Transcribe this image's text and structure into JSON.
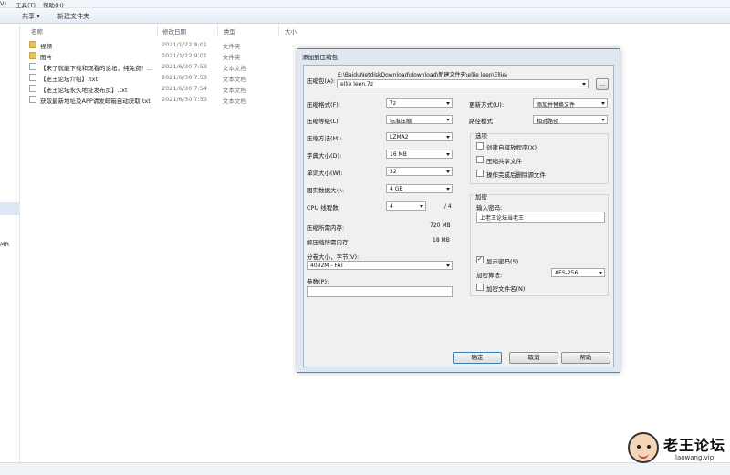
{
  "menu": [
    "V)",
    "工具(T)",
    "帮助(H)"
  ],
  "toolbar": {
    "share": "共享 ▾",
    "new_folder": "新建文件夹"
  },
  "columns": {
    "name": "名称",
    "date": "修改日期",
    "type": "类型",
    "size": "大小"
  },
  "files": [
    {
      "name": "视频",
      "date": "2021/1/22 9:01",
      "type": "文件夹",
      "kind": "folder"
    },
    {
      "name": "图片",
      "date": "2021/1/22 9:01",
      "type": "文件夹",
      "kind": "folder"
    },
    {
      "name": "【来了就能下载和观看的论坛，纯免费！...",
      "date": "2021/6/30 7:53",
      "type": "文本文档",
      "kind": "file"
    },
    {
      "name": "【老王论坛介绍】.txt",
      "date": "2021/6/30 7:53",
      "type": "文本文档",
      "kind": "file"
    },
    {
      "name": "【老王论坛永久地址发布页】.txt",
      "date": "2021/6/30 7:54",
      "type": "文本文档",
      "kind": "file"
    },
    {
      "name": "获取最新地址及APP请发邮箱自动获取.txt",
      "date": "2021/6/30 7:53",
      "type": "文本文档",
      "kind": "file"
    }
  ],
  "nav": {
    "partial_text": "MR"
  },
  "dialog": {
    "title": "添加到压缩包",
    "archive_label": "压缩包(A):",
    "archive_path": "E:\\BaiduNetdiskDownload\\download\\新建文件夹\\ellie leen\\Ellie\\",
    "archive_name": "ellie leen.7z",
    "browse_label": "...",
    "format_label": "压缩格式(F):",
    "format_value": "7z",
    "level_label": "压缩等级(L):",
    "level_value": "标准压缩",
    "method_label": "压缩方法(M):",
    "method_value": "LZMA2",
    "dict_label": "字典大小(D):",
    "dict_value": "16 MB",
    "word_label": "单词大小(W):",
    "word_value": "32",
    "solid_label": "固实数据大小:",
    "solid_value": "4 GB",
    "cpu_label": "CPU 线程数:",
    "cpu_value": "4",
    "cpu_total": "/ 4",
    "mem_comp_label": "压缩所需内存:",
    "mem_comp_value": "720 MB",
    "mem_decomp_label": "解压缩所需内存:",
    "mem_decomp_value": "18 MB",
    "split_label": "分卷大小，字节(V):",
    "split_value": "4092M - FAT",
    "params_label": "参数(P):",
    "update_label": "更新方式(U):",
    "update_value": "添加并替换文件",
    "path_label": "路径模式",
    "path_value": "相对路径",
    "options_title": "选项",
    "opt_sfx": "创建自释放程序(X)",
    "opt_shared": "压缩共享文件",
    "opt_delete": "操作完成后删除源文件",
    "encrypt_title": "加密",
    "password_label": "输入密码:",
    "password_value": "上老王论坛当老王",
    "show_password": "显示密码(S)",
    "enc_method_label": "加密算法:",
    "enc_method_value": "AES-256",
    "enc_names": "加密文件名(N)",
    "ok": "确定",
    "cancel": "取消",
    "help": "帮助"
  },
  "logo": {
    "brand": "老王论坛",
    "site": "laowang.vip"
  }
}
